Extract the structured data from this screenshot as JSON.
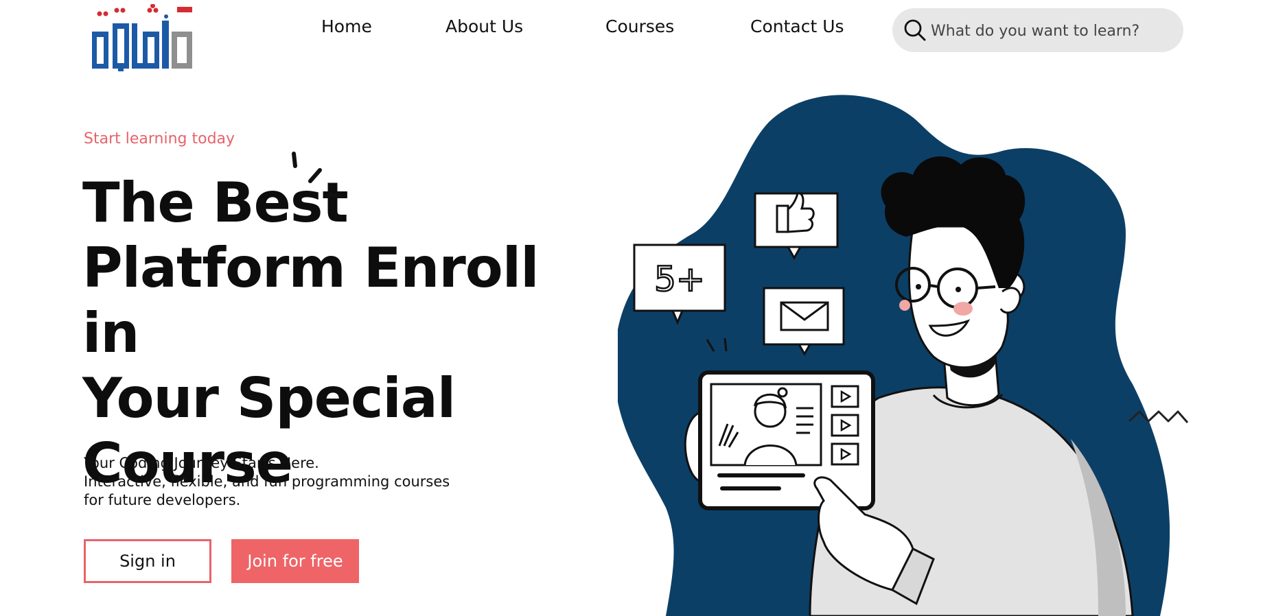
{
  "brand": {
    "logo_text": "aqlnia",
    "colors": {
      "blue": "#1c5aa6",
      "gray": "#8f8f8f",
      "red": "#d62b32"
    }
  },
  "nav": {
    "items": [
      {
        "label": "Home"
      },
      {
        "label": "About Us"
      },
      {
        "label": "Courses"
      },
      {
        "label": "Contact Us"
      }
    ]
  },
  "search": {
    "placeholder": "What do you want to learn?",
    "icon": "search-icon"
  },
  "hero": {
    "eyebrow": "Start learning today",
    "headline": {
      "line1": "The Best",
      "line2": "Platform Enroll in",
      "line3": "Your Special",
      "line4": "Course"
    },
    "subtitle": {
      "line1": "Your Coding Journey Starts Here.",
      "line2": "Interactive, flexible, and fun programming courses",
      "line3": "for future developers."
    },
    "buttons": {
      "signin": "Sign in",
      "join": "Join for free"
    }
  },
  "illustration": {
    "bubble_count": "5+"
  },
  "colors": {
    "accent": "#ee6467",
    "blob": "#0c3f66",
    "search_bg": "#e7e7e7"
  }
}
